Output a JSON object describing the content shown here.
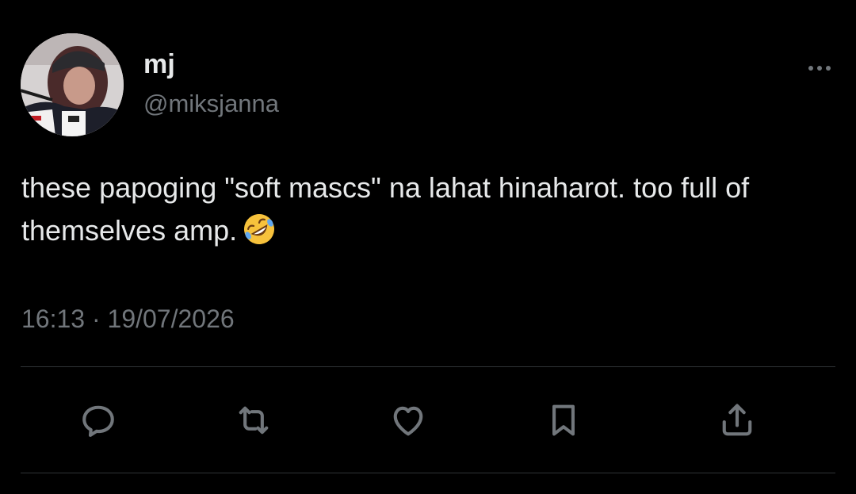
{
  "user": {
    "name": "mj",
    "handle": "@miksjanna",
    "avatar_icon": "profile-photo"
  },
  "tweet": {
    "text": "these papoging \"soft mascs\" na lahat hinaharot. too full of themselves amp.",
    "emoji": "rolling-on-the-floor-laughing-emoji",
    "timestamp": "16:13 · 19/07/2026"
  },
  "actions": [
    {
      "icon": "reply-icon"
    },
    {
      "icon": "retweet-icon"
    },
    {
      "icon": "like-icon"
    },
    {
      "icon": "bookmark-icon"
    },
    {
      "icon": "share-icon"
    }
  ],
  "colors": {
    "background": "#000000",
    "primary_text": "#e7e9ea",
    "secondary_text": "#71767b",
    "divider": "#2f3336"
  }
}
